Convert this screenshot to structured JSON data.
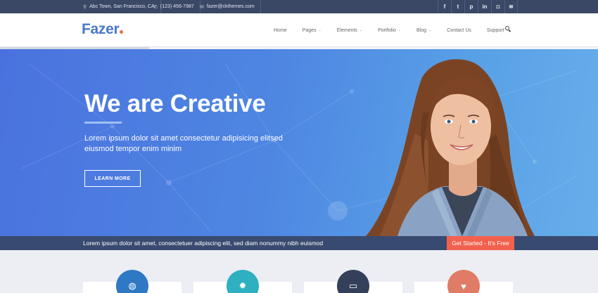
{
  "topbar": {
    "address": "Abc Town, San Francisco, CA",
    "phone": "(123) 456-7987",
    "email": "fazer@ckthemes.com",
    "social": [
      {
        "icon": "facebook-icon",
        "glyph": "f"
      },
      {
        "icon": "twitter-icon",
        "glyph": "t"
      },
      {
        "icon": "pinterest-icon",
        "glyph": "p"
      },
      {
        "icon": "linkedin-icon",
        "glyph": "in"
      },
      {
        "icon": "instagram-icon",
        "glyph": "◘"
      },
      {
        "icon": "rss-icon",
        "glyph": "≋"
      }
    ]
  },
  "nav": {
    "logo": "Fazer",
    "items": [
      {
        "label": "Home",
        "dropdown": false
      },
      {
        "label": "Pages",
        "dropdown": true
      },
      {
        "label": "Elements",
        "dropdown": true
      },
      {
        "label": "Portfolio",
        "dropdown": true
      },
      {
        "label": "Blog",
        "dropdown": true
      },
      {
        "label": "Contact Us",
        "dropdown": false
      },
      {
        "label": "Support",
        "dropdown": true
      }
    ]
  },
  "hero": {
    "title": "We are Creative",
    "text": "Lorem ipsum dolor sit amet consectetur adipisicing elitsed eiusmod tempor enim minim",
    "button": "LEARN MORE"
  },
  "strip": {
    "text": "Lorem ipsum dolor sit amet, consectetuer adipiscing elit, sed diam nonummy nibh euismod",
    "button": "Get Started - It's Free"
  },
  "features": [
    {
      "icon": "globe-icon",
      "glyph": "◍",
      "color": "#2f78c4"
    },
    {
      "icon": "gear-icon",
      "glyph": "✹",
      "color": "#2fb0c0"
    },
    {
      "icon": "laptop-icon",
      "glyph": "▭",
      "color": "#34405a"
    },
    {
      "icon": "heart-icon",
      "glyph": "♥",
      "color": "#e07c66"
    }
  ],
  "colors": {
    "accent": "#4a78c9",
    "cta": "#f2614d",
    "dark": "#394a70"
  }
}
